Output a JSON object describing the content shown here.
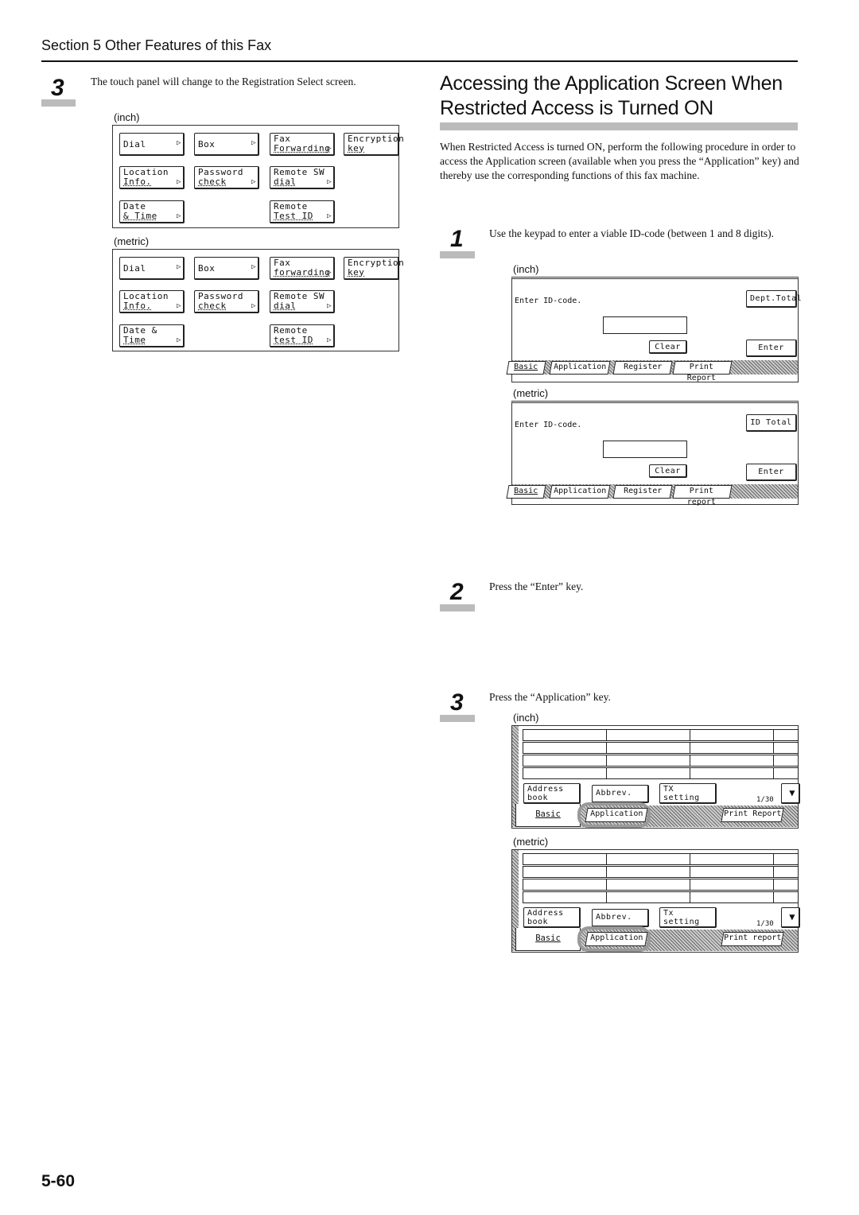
{
  "header": {
    "section": "Section 5  Other Features of this Fax"
  },
  "left_step": {
    "number": "3",
    "text": "The touch panel will change to the Registration Select screen.",
    "inch_label": "(inch)",
    "metric_label": "(metric)",
    "inch_buttons": [
      [
        "Dial",
        ""
      ],
      [
        "Box",
        ""
      ],
      [
        "Fax",
        "Forwarding"
      ],
      [
        "Encryption",
        "key"
      ],
      [
        "Location",
        "Info."
      ],
      [
        "Password",
        "check"
      ],
      [
        "Remote SW",
        "dial"
      ],
      [
        "Date",
        "& Time"
      ],
      [
        "Remote",
        "Test ID"
      ]
    ],
    "metric_buttons": [
      [
        "Dial",
        ""
      ],
      [
        "Box",
        ""
      ],
      [
        "Fax",
        "forwarding"
      ],
      [
        "Encryption",
        "key"
      ],
      [
        "Location",
        "Info."
      ],
      [
        "Password",
        "check"
      ],
      [
        "Remote SW",
        "dial"
      ],
      [
        "Date &",
        "Time"
      ],
      [
        "Remote",
        "test ID"
      ]
    ]
  },
  "title": {
    "line1": "Accessing the Application Screen When",
    "line2": "Restricted Access is Turned ON"
  },
  "intro": "When Restricted Access is turned ON, perform the following procedure in order to access the Application screen (available when you press the “Application” key) and thereby use the corresponding functions of this fax machine.",
  "steps": [
    {
      "number": "1",
      "text": "Use the keypad to enter a viable ID-code (between 1 and 8 digits)."
    },
    {
      "number": "2",
      "text": "Press the “Enter” key."
    },
    {
      "number": "3",
      "text": "Press the “Application” key."
    }
  ],
  "id_screens": {
    "inch_label": "(inch)",
    "metric_label": "(metric)",
    "inch": {
      "prompt": "Enter  ID-code.",
      "total": "Dept.Total",
      "clear": "Clear",
      "enter": "Enter",
      "tabs": [
        "Basic",
        "Application",
        "Register",
        "Print Report"
      ]
    },
    "metric": {
      "prompt": "Enter  ID-code.",
      "total": "ID Total",
      "clear": "Clear",
      "enter": "Enter",
      "tabs": [
        "Basic",
        "Application",
        "Register",
        "Print report"
      ]
    }
  },
  "app_screens": {
    "inch_label": "(inch)",
    "metric_label": "(metric)",
    "inch": {
      "address": [
        "Address",
        "book"
      ],
      "abbrev": "Abbrev.",
      "tx": [
        "TX",
        "setting"
      ],
      "page": "1/30",
      "tabs": [
        "Basic",
        "Application",
        "Print Report"
      ]
    },
    "metric": {
      "address": [
        "Address",
        "book"
      ],
      "abbrev": "Abbrev.",
      "tx": [
        "Tx",
        "setting"
      ],
      "page": "1/30",
      "tabs": [
        "Basic",
        "Application",
        "Print report"
      ]
    }
  },
  "page_number": "5-60",
  "colors": {
    "step_bar": "#bbbbbb",
    "highlight_ring": "#999999"
  }
}
